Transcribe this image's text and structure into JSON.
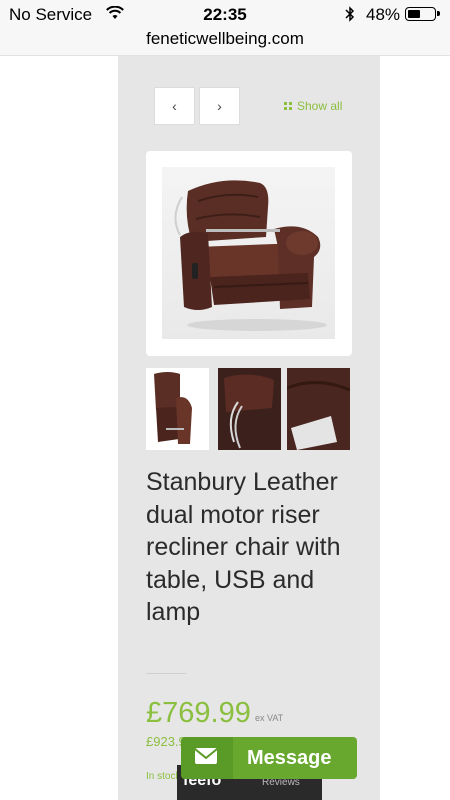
{
  "status_bar": {
    "carrier": "No Service",
    "time": "22:35",
    "battery_pct": "48%",
    "battery_level": 0.48,
    "icons": [
      "wifi-icon",
      "bluetooth-icon",
      "battery-icon"
    ]
  },
  "browser": {
    "url": "feneticwellbeing.com"
  },
  "gallery": {
    "prev_label": "‹",
    "next_label": "›",
    "show_all_label": "Show all",
    "thumbnails_count": 3
  },
  "product": {
    "title": "Stanbury Leather dual motor riser recliner chair with table, USB and lamp",
    "price": "£769.99",
    "price_note": "ex VAT",
    "price_inc_vat": "£923.99",
    "stock": "In stock"
  },
  "feefo": {
    "logo_text": "feefo",
    "reviews_label": "Reviews"
  },
  "chat": {
    "label": "Message"
  },
  "colors": {
    "accent": "#8bbf3f",
    "message_button": "#68a82e",
    "column_bg": "#e6e6e6",
    "leather": "#5a2f27"
  }
}
